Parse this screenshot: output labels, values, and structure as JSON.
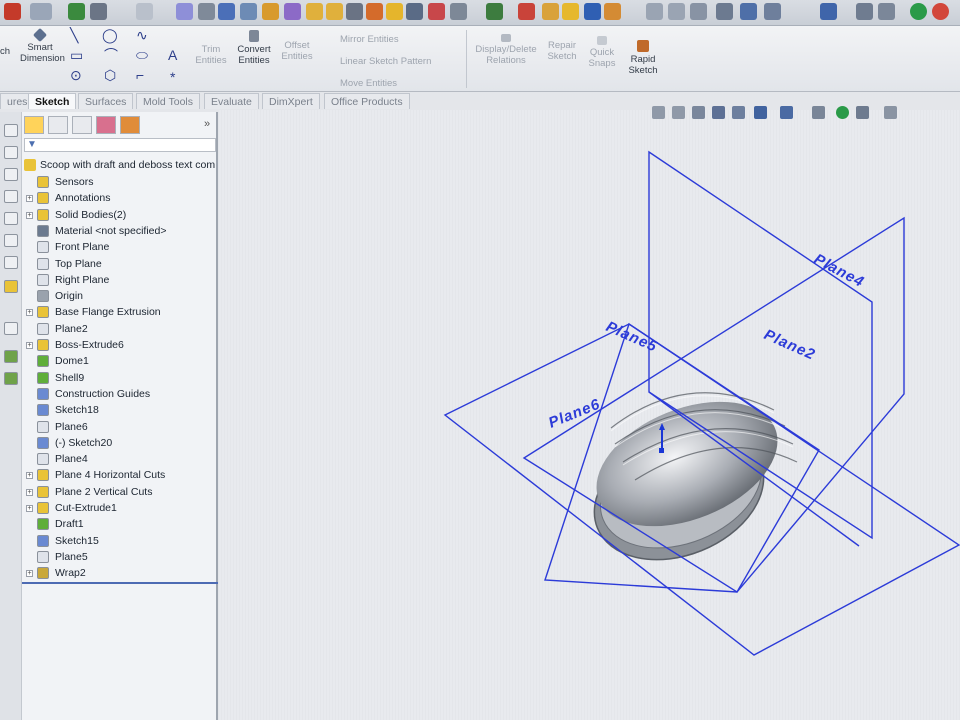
{
  "ribbon": {
    "sketch_label": "ch",
    "smart_dimension": "Smart Dimension",
    "trim_entities": "Trim Entities",
    "convert_entities": "Convert Entities",
    "offset_entities": "Offset Entities",
    "mirror_entities": "Mirror Entities",
    "linear_sketch_pattern": "Linear Sketch Pattern",
    "move_entities": "Move Entities",
    "display_delete_relations": "Display/Delete Relations",
    "repair_sketch": "Repair Sketch",
    "quick_snaps": "Quick Snaps",
    "rapid_sketch": "Rapid Sketch"
  },
  "tabs": [
    {
      "label": "ures"
    },
    {
      "label": "Sketch"
    },
    {
      "label": "Surfaces"
    },
    {
      "label": "Mold Tools"
    },
    {
      "label": "Evaluate"
    },
    {
      "label": "DimXpert"
    },
    {
      "label": "Office Products"
    }
  ],
  "feature_tree": {
    "root": "Scoop with draft and deboss text com",
    "items": [
      {
        "label": "Sensors",
        "icon": "sensor-icon"
      },
      {
        "label": "Annotations",
        "icon": "annotation-icon"
      },
      {
        "label": "Solid Bodies(2)",
        "icon": "solid-bodies-icon"
      },
      {
        "label": "Material <not specified>",
        "icon": "material-icon"
      },
      {
        "label": "Front Plane",
        "icon": "plane-icon"
      },
      {
        "label": "Top Plane",
        "icon": "plane-icon"
      },
      {
        "label": "Right Plane",
        "icon": "plane-icon"
      },
      {
        "label": "Origin",
        "icon": "origin-icon"
      },
      {
        "label": "Base Flange Extrusion",
        "icon": "feature-icon"
      },
      {
        "label": "Plane2",
        "icon": "plane-icon"
      },
      {
        "label": "Boss-Extrude6",
        "icon": "feature-icon"
      },
      {
        "label": "Dome1",
        "icon": "dome-icon"
      },
      {
        "label": "Shell9",
        "icon": "shell-icon"
      },
      {
        "label": "Construction Guides",
        "icon": "sketch-icon"
      },
      {
        "label": "Sketch18",
        "icon": "sketch-icon"
      },
      {
        "label": "Plane6",
        "icon": "plane-icon"
      },
      {
        "label": "(-) Sketch20",
        "icon": "sketch-icon"
      },
      {
        "label": "Plane4",
        "icon": "plane-icon"
      },
      {
        "label": "Plane 4 Horizontal Cuts",
        "icon": "feature-icon"
      },
      {
        "label": "Plane 2 Vertical Cuts",
        "icon": "feature-icon"
      },
      {
        "label": "Cut-Extrude1",
        "icon": "feature-icon"
      },
      {
        "label": "Draft1",
        "icon": "draft-icon"
      },
      {
        "label": "Sketch15",
        "icon": "sketch-icon"
      },
      {
        "label": "Plane5",
        "icon": "plane-icon"
      },
      {
        "label": "Wrap2",
        "icon": "wrap-icon"
      }
    ]
  },
  "viewport": {
    "planes": [
      "Plane4",
      "Plane5",
      "Plane2",
      "Plane6"
    ]
  },
  "colors": {
    "plane_lines": "#2c3bd8",
    "active_tab": "#f7f8fa",
    "feature_yellow": "#e9c338"
  }
}
